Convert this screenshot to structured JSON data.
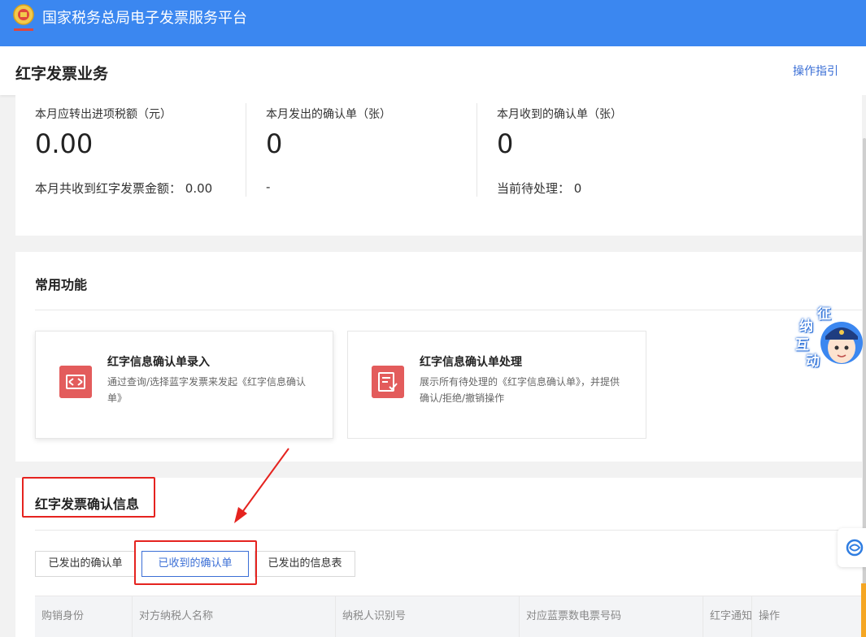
{
  "app": {
    "title": "国家税务总局电子发票服务平台"
  },
  "header": {
    "title": "红字发票业务",
    "guide_link": "操作指引"
  },
  "stats": [
    {
      "label": "本月应转出进项税额（元）",
      "value": "0.00",
      "sub": "本月共收到红字发票金额：  0.00"
    },
    {
      "label": "本月发出的确认单（张）",
      "value": "0",
      "sub": "-"
    },
    {
      "label": "本月收到的确认单（张）",
      "value": "0",
      "sub": "当前待处理：  0"
    }
  ],
  "common_functions": {
    "title": "常用功能",
    "items": [
      {
        "title": "红字信息确认单录入",
        "desc": "通过查询/选择蓝字发票来发起《红字信息确认单》",
        "icon": "swap-arrows-icon"
      },
      {
        "title": "红字信息确认单处理",
        "desc": "展示所有待处理的《红字信息确认单》，并提供确认/拒绝/撤销操作",
        "icon": "document-check-icon"
      }
    ]
  },
  "confirm_info": {
    "title": "红字发票确认信息",
    "tabs": [
      {
        "label": "已发出的确认单",
        "active": false
      },
      {
        "label": "已收到的确认单",
        "active": true
      },
      {
        "label": "已发出的信息表",
        "active": false
      }
    ],
    "columns": [
      "购销身份",
      "对方纳税人名称",
      "纳税人识别号",
      "对应蓝票数电票号码",
      "红字通知",
      "操作"
    ]
  },
  "helper": {
    "chars": [
      "征",
      "纳",
      "互",
      "动"
    ]
  },
  "colors": {
    "topbar": "#3b87f0",
    "accent": "#3b6fd6",
    "highlight": "#e5231f",
    "icon_red": "#e35c5c"
  }
}
